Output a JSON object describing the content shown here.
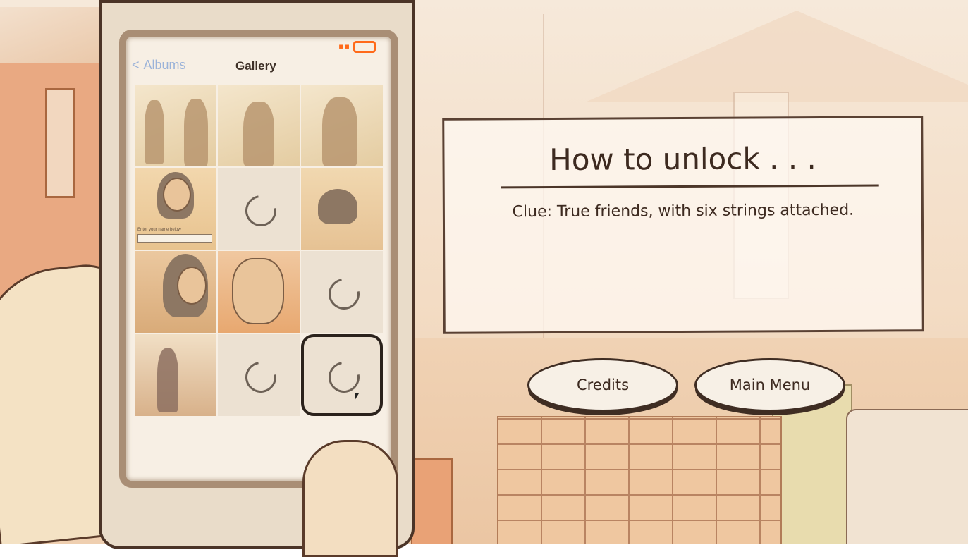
{
  "phone": {
    "nav": {
      "back_label": "Albums",
      "title": "Gallery"
    },
    "gallery": {
      "cells": [
        {
          "type": "silhouette"
        },
        {
          "type": "silhouette"
        },
        {
          "type": "silhouette"
        },
        {
          "type": "photo"
        },
        {
          "type": "loading"
        },
        {
          "type": "photo"
        },
        {
          "type": "photo"
        },
        {
          "type": "photo"
        },
        {
          "type": "loading"
        },
        {
          "type": "photo"
        },
        {
          "type": "loading"
        },
        {
          "type": "loading",
          "selected": true
        }
      ],
      "enter_name_caption": "Enter your name below"
    },
    "status": {
      "accent_color": "#ff6a1a"
    }
  },
  "panel": {
    "title": "How to unlock . . .",
    "clue": "Clue: True friends, with six strings attached."
  },
  "buttons": {
    "credits": "Credits",
    "main_menu": "Main Menu"
  }
}
